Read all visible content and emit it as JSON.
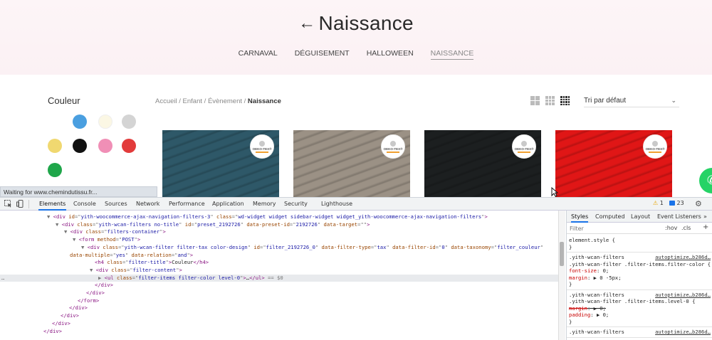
{
  "site": {
    "hero": {
      "arrow": "←",
      "title": "Naissance"
    },
    "categories": [
      {
        "label": "CARNAVAL",
        "active": false
      },
      {
        "label": "DÉGUISEMENT",
        "active": false
      },
      {
        "label": "HALLOWEEN",
        "active": false
      },
      {
        "label": "NAISSANCE",
        "active": true
      }
    ],
    "filter": {
      "title": "Couleur",
      "swatches": [
        {
          "name": "bleu",
          "color": "#4a9fe0"
        },
        {
          "name": "beige",
          "color": "#fbf7e4"
        },
        {
          "name": "gris",
          "color": "#d4d4d4"
        },
        {
          "name": "jaune",
          "color": "#f0d870"
        },
        {
          "name": "noir",
          "color": "#111111"
        },
        {
          "name": "rose",
          "color": "#f08fb6"
        },
        {
          "name": "rouge",
          "color": "#e23b3b"
        },
        {
          "name": "vert",
          "color": "#1fa64a"
        }
      ]
    },
    "breadcrumb": {
      "items": [
        "Accueil",
        "Enfant",
        "Évènement"
      ],
      "separator": "/",
      "current": "Naissance"
    },
    "sort": {
      "value": "Tri par défaut",
      "chevron": "⌄"
    },
    "products": [
      {
        "color": "#2e5868",
        "badge": "OEKO-TEX®"
      },
      {
        "color": "#9b9185",
        "badge": "OEKO-TEX®"
      },
      {
        "color": "#1c1f20",
        "badge": "OEKO-TEX®"
      },
      {
        "color": "#e01616",
        "badge": "OEKO-TEX®"
      }
    ],
    "whatsapp_icon": "✆",
    "status": "Waiting for www.chemindutissu.fr..."
  },
  "devtools": {
    "tabs": [
      "Elements",
      "Console",
      "Sources",
      "Network",
      "Performance",
      "Application",
      "Memory",
      "Security",
      "Lighthouse"
    ],
    "active_tab": "Elements",
    "warnings": "1",
    "issues": "23",
    "warning_icon": "⚠",
    "gear_icon": "⚙",
    "code": [
      {
        "indent": 0,
        "arrow": "▼",
        "open": "<div ",
        "attrs": [
          [
            "id",
            "yith-woocommerce-ajax-navigation-filters-3"
          ],
          [
            "class",
            "wd-widget widget sidebar-widget widget_yith-woocommerce-ajax-navigation-filters"
          ]
        ],
        "close": ">"
      },
      {
        "indent": 1,
        "arrow": "▼",
        "open": "<div ",
        "attrs": [
          [
            "class",
            "yith-wcan-filters no-title"
          ],
          [
            "id",
            "preset_2192726"
          ],
          [
            "data-preset-id",
            "2192726"
          ],
          [
            "data-target",
            ""
          ]
        ],
        "close": ">"
      },
      {
        "indent": 2,
        "arrow": "▼",
        "open": "<div ",
        "attrs": [
          [
            "class",
            "filters-container"
          ]
        ],
        "close": ">"
      },
      {
        "indent": 3,
        "arrow": "▼",
        "open": "<form ",
        "attrs": [
          [
            "method",
            "POST"
          ]
        ],
        "close": ">"
      },
      {
        "indent": 4,
        "arrow": "▼",
        "open": "<div ",
        "attrs": [
          [
            "class",
            "yith-wcan-filter filter-tax color-design"
          ],
          [
            "id",
            "filter_2192726_0"
          ],
          [
            "data-filter-type",
            "tax"
          ],
          [
            "data-filter-id",
            "0"
          ],
          [
            "data-taxonomy",
            "filter_couleur"
          ]
        ],
        "close": ""
      },
      {
        "indent": 5,
        "arrow": "",
        "open": "",
        "attrs": [
          [
            "data-multiple",
            "yes"
          ],
          [
            "data-relation",
            "and"
          ]
        ],
        "close": ">"
      },
      {
        "indent": 5,
        "arrow": "",
        "open": "<h4 ",
        "attrs": [
          [
            "class",
            "filter-title"
          ]
        ],
        "close": ">",
        "text": "Couleur",
        "end": "</h4>"
      },
      {
        "indent": 5,
        "arrow": "▼",
        "open": "<div ",
        "attrs": [
          [
            "class",
            "filter-content"
          ]
        ],
        "close": ">"
      },
      {
        "indent": 6,
        "arrow": "▶",
        "open": "<ul ",
        "attrs": [
          [
            "class",
            "filter-items filter-color  level-0"
          ]
        ],
        "close": ">",
        "text": "…",
        "end": "</ul>",
        "suffix": " == $0",
        "selected": true
      },
      {
        "indent": 5,
        "arrow": "",
        "open": "",
        "attrs": [],
        "close": "",
        "end": "</div>"
      },
      {
        "indent": 4,
        "arrow": "",
        "open": "",
        "attrs": [],
        "close": "",
        "end": "</div>"
      },
      {
        "indent": 3,
        "arrow": "",
        "open": "",
        "attrs": [],
        "close": "",
        "end": "</form>"
      },
      {
        "indent": 2,
        "arrow": "",
        "open": "",
        "attrs": [],
        "close": "",
        "end": "</div>"
      },
      {
        "indent": 1,
        "arrow": "",
        "open": "",
        "attrs": [],
        "close": "",
        "end": "</div>"
      },
      {
        "indent": 0,
        "arrow": "",
        "open": "",
        "attrs": [],
        "close": "",
        "end": "</div>"
      },
      {
        "indent": -1,
        "arrow": "",
        "open": "",
        "attrs": [],
        "close": "",
        "end": "</div>"
      }
    ],
    "styles": {
      "tabs": [
        "Styles",
        "Computed",
        "Layout",
        "Event Listeners",
        "»"
      ],
      "active_tab": "Styles",
      "filter_placeholder": "Filter",
      "hov": ":hov",
      "cls": ".cls",
      "plus": "+",
      "rules": [
        {
          "lines": [
            "element.style {",
            "}"
          ],
          "source": ""
        },
        {
          "lines": [
            ".yith-wcan-filters",
            ".yith-wcan-filter .filter-items.filter-color {",
            "  font-size: 0;",
            "  margin: ▶ 0 -5px;",
            "}"
          ],
          "source": "autoptimize…b286d…"
        },
        {
          "lines": [
            ".yith-wcan-filters",
            ".yith-wcan-filter .filter-items.level-0 {",
            "  margin: ▶ 0;",
            "  padding: ▶ 0;",
            "}"
          ],
          "source": "autoptimize…b286d…"
        },
        {
          "lines": [
            ".yith-wcan-filters"
          ],
          "source": "autoptimize…b286d…"
        }
      ]
    }
  }
}
